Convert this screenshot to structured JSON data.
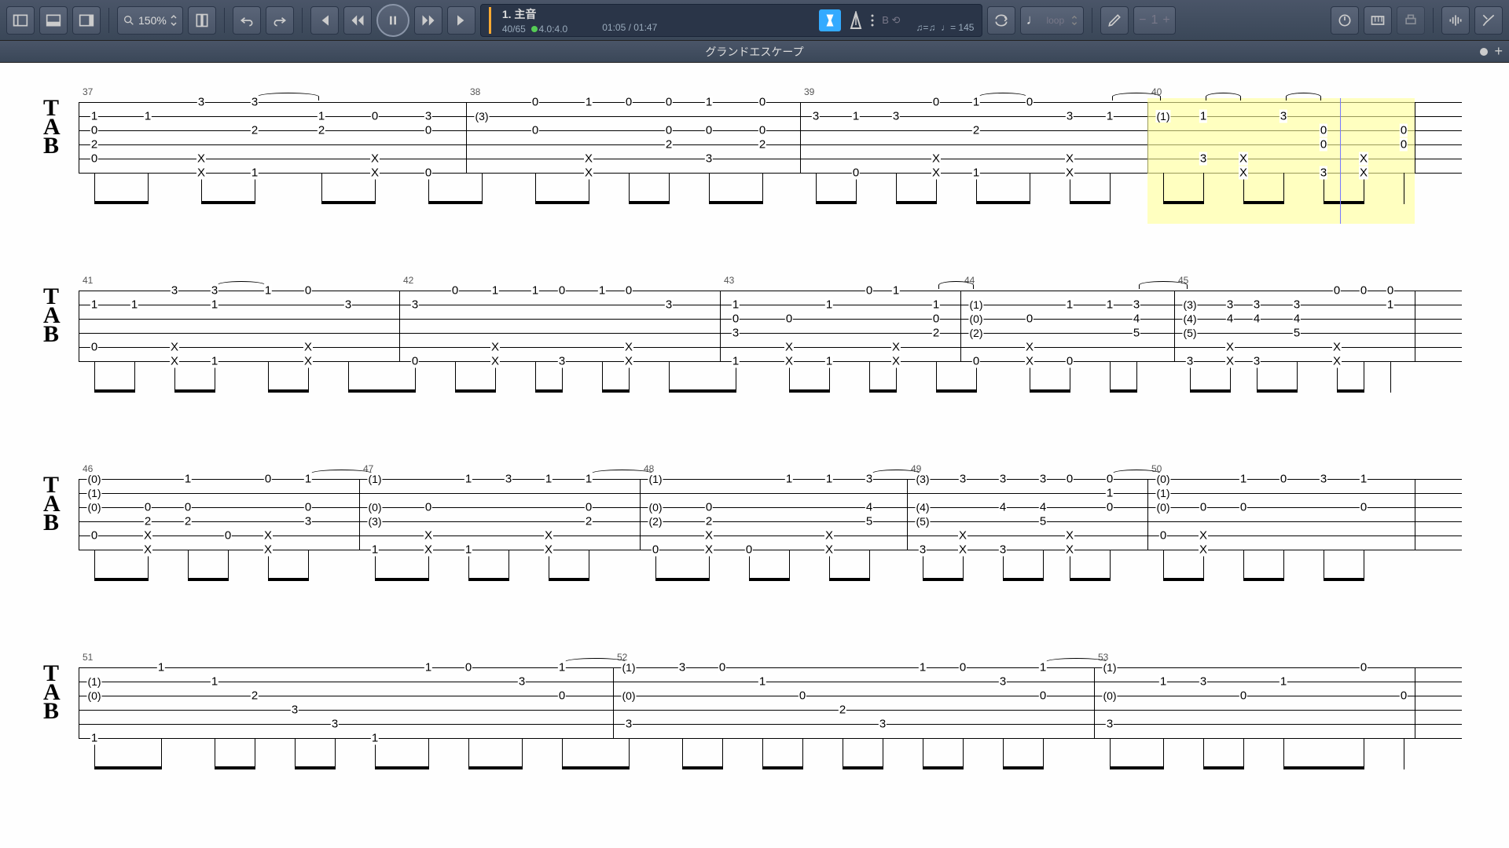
{
  "toolbar": {
    "zoom": "150%",
    "track_name": "1. 主音",
    "measure_pos": "40/65",
    "beat_pos": "4.0:4.0",
    "time_pos": "01:05 / 01:47",
    "swing": "♫=♫",
    "tempo_label": "♩= 145",
    "loop_label": "loop"
  },
  "title": "グランドエスケープ",
  "chart_data": {
    "type": "tablature",
    "instrument": "guitar-6-string",
    "title": "グランドエスケープ",
    "tempo_bpm": 145,
    "current_measure": 40,
    "total_measures": 65,
    "systems": [
      {
        "measures": [
          37,
          38,
          39,
          40
        ],
        "highlight_measure": 40,
        "columns": [
          {
            "m": 37,
            "x": 0.0,
            "n": {
              "2": 1,
              "3": 0,
              "4": 2,
              "5": 0
            }
          },
          {
            "m": 37,
            "x": 0.04,
            "n": {
              "2": 1
            }
          },
          {
            "m": 37,
            "x": 0.08,
            "n": {
              "1": 3,
              "5": "X",
              "6": "X"
            }
          },
          {
            "m": 37,
            "x": 0.12,
            "n": {
              "1": 3,
              "3": 2,
              "6": 1
            },
            "tie_after": true
          },
          {
            "m": 37,
            "x": 0.17,
            "n": {
              "2": 1,
              "3": 2
            }
          },
          {
            "m": 37,
            "x": 0.21,
            "n": {
              "2": 0,
              "5": "X",
              "6": "X"
            }
          },
          {
            "m": 37,
            "x": 0.25,
            "n": {
              "2": 3,
              "3": 0,
              "6": 0
            }
          },
          {
            "m": 38,
            "x": 0.29,
            "n": {
              "2": "(3)"
            }
          },
          {
            "m": 38,
            "x": 0.33,
            "n": {
              "1": 0,
              "3": 0
            }
          },
          {
            "m": 38,
            "x": 0.37,
            "n": {
              "1": 1,
              "5": "X",
              "6": "X"
            }
          },
          {
            "m": 38,
            "x": 0.4,
            "n": {
              "1": 0
            }
          },
          {
            "m": 38,
            "x": 0.43,
            "n": {
              "1": 0,
              "3": 0,
              "4": 2
            }
          },
          {
            "m": 38,
            "x": 0.46,
            "n": {
              "1": 1,
              "3": 0,
              "5": 3
            }
          },
          {
            "m": 38,
            "x": 0.5,
            "n": {
              "1": 0,
              "3": 0,
              "4": 2
            }
          },
          {
            "m": 39,
            "x": 0.54,
            "n": {
              "2": 3
            }
          },
          {
            "m": 39,
            "x": 0.57,
            "n": {
              "2": 1,
              "6": 0
            }
          },
          {
            "m": 39,
            "x": 0.6,
            "n": {
              "2": 3
            }
          },
          {
            "m": 39,
            "x": 0.63,
            "n": {
              "1": 0,
              "5": "X",
              "6": "X"
            }
          },
          {
            "m": 39,
            "x": 0.66,
            "n": {
              "1": 1,
              "3": 2,
              "6": 1
            },
            "tie_after": true
          },
          {
            "m": 39,
            "x": 0.7,
            "n": {
              "1": 0
            }
          },
          {
            "m": 39,
            "x": 0.73,
            "n": {
              "2": 3,
              "5": "X",
              "6": "X"
            }
          },
          {
            "m": 39,
            "x": 0.76,
            "n": {
              "2": 1
            },
            "tie_after": true
          },
          {
            "m": 40,
            "x": 0.8,
            "n": {
              "2": "(1)"
            }
          },
          {
            "m": 40,
            "x": 0.83,
            "n": {
              "2": 1,
              "5": 3
            },
            "tie_after": true
          },
          {
            "m": 40,
            "x": 0.86,
            "n": {
              "5": "X",
              "6": "X"
            }
          },
          {
            "m": 40,
            "x": 0.89,
            "n": {
              "2": 3
            },
            "tie_after": true
          },
          {
            "m": 40,
            "x": 0.92,
            "n": {
              "3": 0,
              "4": 0,
              "6": 3
            }
          },
          {
            "m": 40,
            "x": 0.95,
            "n": {
              "5": "X",
              "6": "X"
            }
          },
          {
            "m": 40,
            "x": 0.98,
            "n": {
              "3": 0,
              "4": 0
            }
          }
        ]
      },
      {
        "measures": [
          41,
          42,
          43,
          44,
          45
        ],
        "columns": [
          {
            "m": 41,
            "x": 0.0,
            "n": {
              "2": 1,
              "5": 0
            }
          },
          {
            "m": 41,
            "x": 0.03,
            "n": {
              "2": 1
            }
          },
          {
            "m": 41,
            "x": 0.06,
            "n": {
              "1": 3,
              "5": "X",
              "6": "X"
            }
          },
          {
            "m": 41,
            "x": 0.09,
            "n": {
              "1": 3,
              "2": 1,
              "6": 1
            },
            "tie_after": true
          },
          {
            "m": 41,
            "x": 0.13,
            "n": {
              "1": 1
            }
          },
          {
            "m": 41,
            "x": 0.16,
            "n": {
              "1": 0,
              "5": "X",
              "6": "X"
            }
          },
          {
            "m": 41,
            "x": 0.19,
            "n": {
              "2": 3
            }
          },
          {
            "m": 42,
            "x": 0.24,
            "n": {
              "2": 3,
              "6": 0
            }
          },
          {
            "m": 42,
            "x": 0.27,
            "n": {
              "1": 0
            }
          },
          {
            "m": 42,
            "x": 0.3,
            "n": {
              "1": 1,
              "5": "X",
              "6": "X"
            }
          },
          {
            "m": 42,
            "x": 0.33,
            "n": {
              "1": 1
            }
          },
          {
            "m": 42,
            "x": 0.35,
            "n": {
              "1": 0,
              "6": 3
            }
          },
          {
            "m": 42,
            "x": 0.38,
            "n": {
              "1": 1
            }
          },
          {
            "m": 42,
            "x": 0.4,
            "n": {
              "1": 0,
              "5": "X",
              "6": "X"
            }
          },
          {
            "m": 42,
            "x": 0.43,
            "n": {
              "2": 3
            }
          },
          {
            "m": 43,
            "x": 0.48,
            "n": {
              "2": 1,
              "3": 0,
              "4": 3,
              "6": 1
            }
          },
          {
            "m": 43,
            "x": 0.52,
            "n": {
              "3": 0,
              "5": "X",
              "6": "X"
            }
          },
          {
            "m": 43,
            "x": 0.55,
            "n": {
              "2": 1,
              "6": 1
            }
          },
          {
            "m": 43,
            "x": 0.58,
            "n": {
              "1": 0
            }
          },
          {
            "m": 43,
            "x": 0.6,
            "n": {
              "1": 1,
              "5": "X",
              "6": "X"
            }
          },
          {
            "m": 43,
            "x": 0.63,
            "n": {
              "2": 1,
              "3": 0,
              "4": 2
            },
            "tie_after": true
          },
          {
            "m": 44,
            "x": 0.66,
            "n": {
              "2": "(1)",
              "3": "(0)",
              "4": "(2)",
              "6": 0
            }
          },
          {
            "m": 44,
            "x": 0.7,
            "n": {
              "3": 0,
              "5": "X",
              "6": "X"
            }
          },
          {
            "m": 44,
            "x": 0.73,
            "n": {
              "2": 1,
              "6": 0
            }
          },
          {
            "m": 44,
            "x": 0.76,
            "n": {
              "2": 1
            }
          },
          {
            "m": 44,
            "x": 0.78,
            "n": {
              "2": 3,
              "3": 4,
              "4": 5
            },
            "tie_after": true
          },
          {
            "m": 45,
            "x": 0.82,
            "n": {
              "2": "(3)",
              "3": "(4)",
              "4": "(5)",
              "6": 3
            }
          },
          {
            "m": 45,
            "x": 0.85,
            "n": {
              "2": 3,
              "3": 4,
              "5": "X",
              "6": "X"
            }
          },
          {
            "m": 45,
            "x": 0.87,
            "n": {
              "2": 3,
              "3": 4,
              "6": 3
            }
          },
          {
            "m": 45,
            "x": 0.9,
            "n": {
              "2": 3,
              "3": 4,
              "4": 5
            }
          },
          {
            "m": 45,
            "x": 0.93,
            "n": {
              "1": 0,
              "5": "X",
              "6": "X"
            }
          },
          {
            "m": 45,
            "x": 0.95,
            "n": {
              "1": 0
            }
          },
          {
            "m": 45,
            "x": 0.97,
            "n": {
              "1": 0,
              "2": 1
            },
            "tie_after": true
          }
        ]
      },
      {
        "measures": [
          46,
          47,
          48,
          49,
          50
        ],
        "columns": [
          {
            "m": 46,
            "x": 0.0,
            "n": {
              "1": "(0)",
              "2": "(1)",
              "3": "(0)",
              "5": 0
            }
          },
          {
            "m": 46,
            "x": 0.04,
            "n": {
              "3": 0,
              "4": 2,
              "5": "X",
              "6": "X"
            }
          },
          {
            "m": 46,
            "x": 0.07,
            "n": {
              "1": 1,
              "3": 0,
              "4": 2
            }
          },
          {
            "m": 46,
            "x": 0.1,
            "n": {
              "5": 0
            }
          },
          {
            "m": 46,
            "x": 0.13,
            "n": {
              "1": 0,
              "5": "X",
              "6": "X"
            }
          },
          {
            "m": 46,
            "x": 0.16,
            "n": {
              "1": 1,
              "3": 0,
              "4": 3
            },
            "tie_after": true
          },
          {
            "m": 47,
            "x": 0.21,
            "n": {
              "1": "(1)",
              "3": "(0)",
              "4": "(3)",
              "6": 1
            }
          },
          {
            "m": 47,
            "x": 0.25,
            "n": {
              "3": 0,
              "5": "X",
              "6": "X"
            }
          },
          {
            "m": 47,
            "x": 0.28,
            "n": {
              "1": 1,
              "6": 1
            }
          },
          {
            "m": 47,
            "x": 0.31,
            "n": {
              "1": 3
            }
          },
          {
            "m": 47,
            "x": 0.34,
            "n": {
              "1": 1,
              "5": "X",
              "6": "X"
            }
          },
          {
            "m": 47,
            "x": 0.37,
            "n": {
              "1": 1,
              "3": 0,
              "4": 2
            },
            "tie_after": true
          },
          {
            "m": 48,
            "x": 0.42,
            "n": {
              "1": "(1)",
              "3": "(0)",
              "4": "(2)",
              "6": 0
            }
          },
          {
            "m": 48,
            "x": 0.46,
            "n": {
              "3": 0,
              "4": 2,
              "5": "X",
              "6": "X"
            }
          },
          {
            "m": 48,
            "x": 0.49,
            "n": {
              "6": 0
            }
          },
          {
            "m": 48,
            "x": 0.52,
            "n": {
              "1": 1
            }
          },
          {
            "m": 48,
            "x": 0.55,
            "n": {
              "1": 1,
              "5": "X",
              "6": "X"
            }
          },
          {
            "m": 48,
            "x": 0.58,
            "n": {
              "1": 3,
              "3": 4,
              "4": 5
            },
            "tie_after": true
          },
          {
            "m": 49,
            "x": 0.62,
            "n": {
              "1": "(3)",
              "3": "(4)",
              "4": "(5)",
              "6": 3
            }
          },
          {
            "m": 49,
            "x": 0.65,
            "n": {
              "1": 3,
              "5": "X",
              "6": "X"
            }
          },
          {
            "m": 49,
            "x": 0.68,
            "n": {
              "1": 3,
              "3": 4,
              "6": 3
            }
          },
          {
            "m": 49,
            "x": 0.71,
            "n": {
              "1": 3,
              "3": 4,
              "4": 5
            }
          },
          {
            "m": 49,
            "x": 0.73,
            "n": {
              "1": 0,
              "5": "X",
              "6": "X"
            }
          },
          {
            "m": 49,
            "x": 0.76,
            "n": {
              "1": 0,
              "2": 1,
              "3": 0
            },
            "tie_after": true
          },
          {
            "m": 50,
            "x": 0.8,
            "n": {
              "1": "(0)",
              "2": "(1)",
              "3": "(0)",
              "5": 0
            }
          },
          {
            "m": 50,
            "x": 0.83,
            "n": {
              "3": 0,
              "5": "X",
              "6": "X"
            }
          },
          {
            "m": 50,
            "x": 0.86,
            "n": {
              "1": 1,
              "3": 0
            }
          },
          {
            "m": 50,
            "x": 0.89,
            "n": {
              "1": 0
            }
          },
          {
            "m": 50,
            "x": 0.92,
            "n": {
              "1": 3
            }
          },
          {
            "m": 50,
            "x": 0.95,
            "n": {
              "1": 1,
              "3": 0
            },
            "tie_after": true
          }
        ]
      },
      {
        "measures": [
          51,
          52,
          53
        ],
        "columns": [
          {
            "m": 51,
            "x": 0.0,
            "n": {
              "2": "(1)",
              "3": "(0)",
              "6": 1
            }
          },
          {
            "m": 51,
            "x": 0.05,
            "n": {
              "1": 1
            }
          },
          {
            "m": 51,
            "x": 0.09,
            "n": {
              "2": 1
            }
          },
          {
            "m": 51,
            "x": 0.12,
            "n": {
              "3": 2
            }
          },
          {
            "m": 51,
            "x": 0.15,
            "n": {
              "4": 3
            }
          },
          {
            "m": 51,
            "x": 0.18,
            "n": {
              "5": 3
            }
          },
          {
            "m": 51,
            "x": 0.21,
            "n": {
              "6": 1
            }
          },
          {
            "m": 51,
            "x": 0.25,
            "n": {
              "1": 1
            }
          },
          {
            "m": 51,
            "x": 0.28,
            "n": {
              "1": 0
            }
          },
          {
            "m": 51,
            "x": 0.32,
            "n": {
              "2": 3
            }
          },
          {
            "m": 51,
            "x": 0.35,
            "n": {
              "1": 1,
              "3": 0
            },
            "tie_after": true
          },
          {
            "m": 52,
            "x": 0.4,
            "n": {
              "1": "(1)",
              "3": "(0)",
              "5": 3
            }
          },
          {
            "m": 52,
            "x": 0.44,
            "n": {
              "1": 3
            }
          },
          {
            "m": 52,
            "x": 0.47,
            "n": {
              "1": 0
            }
          },
          {
            "m": 52,
            "x": 0.5,
            "n": {
              "2": 1
            }
          },
          {
            "m": 52,
            "x": 0.53,
            "n": {
              "3": 0
            }
          },
          {
            "m": 52,
            "x": 0.56,
            "n": {
              "4": 2
            }
          },
          {
            "m": 52,
            "x": 0.59,
            "n": {
              "5": 3
            }
          },
          {
            "m": 52,
            "x": 0.62,
            "n": {
              "1": 1
            }
          },
          {
            "m": 52,
            "x": 0.65,
            "n": {
              "1": 0
            }
          },
          {
            "m": 52,
            "x": 0.68,
            "n": {
              "2": 3
            }
          },
          {
            "m": 52,
            "x": 0.71,
            "n": {
              "1": 1,
              "3": 0
            },
            "tie_after": true
          },
          {
            "m": 53,
            "x": 0.76,
            "n": {
              "1": "(1)",
              "3": "(0)",
              "5": 3
            }
          },
          {
            "m": 53,
            "x": 0.8,
            "n": {
              "2": 1
            }
          },
          {
            "m": 53,
            "x": 0.83,
            "n": {
              "2": 3
            }
          },
          {
            "m": 53,
            "x": 0.86,
            "n": {
              "3": 0
            }
          },
          {
            "m": 53,
            "x": 0.89,
            "n": {
              "2": 1
            }
          },
          {
            "m": 53,
            "x": 0.95,
            "n": {
              "1": 0
            }
          },
          {
            "m": 53,
            "x": 0.98,
            "n": {
              "3": 0
            }
          }
        ]
      }
    ]
  }
}
